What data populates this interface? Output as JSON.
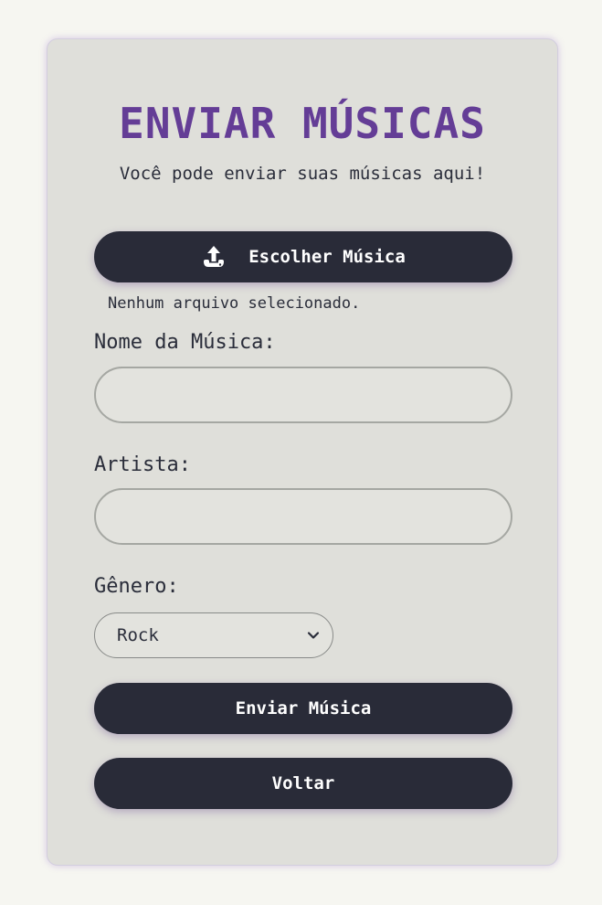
{
  "page": {
    "title": "ENVIAR MÚSICAS",
    "subtitle": "Você pode enviar suas músicas aqui!"
  },
  "upload": {
    "button_label": "Escolher Música",
    "icon": "upload-icon",
    "status": "Nenhum arquivo selecionado."
  },
  "form": {
    "song_name_label": "Nome da Música:",
    "song_name_value": "",
    "artist_label": "Artista:",
    "artist_value": "",
    "genre_label": "Gênero:",
    "genre_selected": "Rock"
  },
  "actions": {
    "submit_label": "Enviar Música",
    "back_label": "Voltar"
  },
  "colors": {
    "background": "#f6f6f1",
    "card": "#dfdfda",
    "title": "#643d96",
    "button": "#292b38",
    "button_text": "#ffffff"
  }
}
